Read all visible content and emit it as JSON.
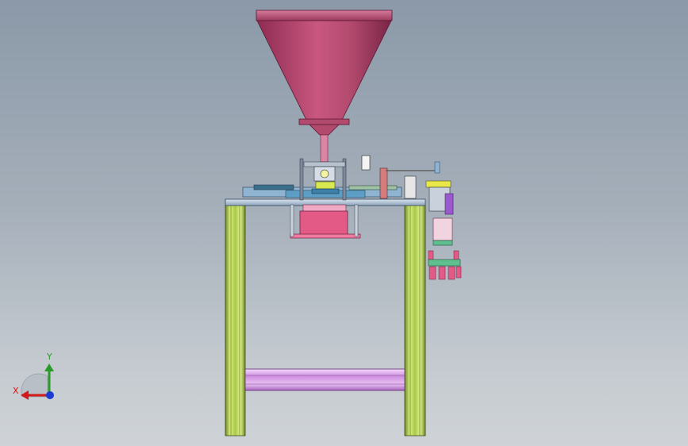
{
  "scene": {
    "background_top": "#8b99a8",
    "background_bottom": "#cfd3d7",
    "hopper_color": "#b24a6e",
    "frame_color": "#c8e86a",
    "cross_beam_color": "#d9a3e6",
    "base_block_color": "#e35a86",
    "plate_color": "#7fa4c6"
  },
  "triad": {
    "x_label": "X",
    "y_label": "Y",
    "x_color": "#d11a1a",
    "y_color": "#2a9a2a",
    "z_color": "#1a3ad1"
  }
}
